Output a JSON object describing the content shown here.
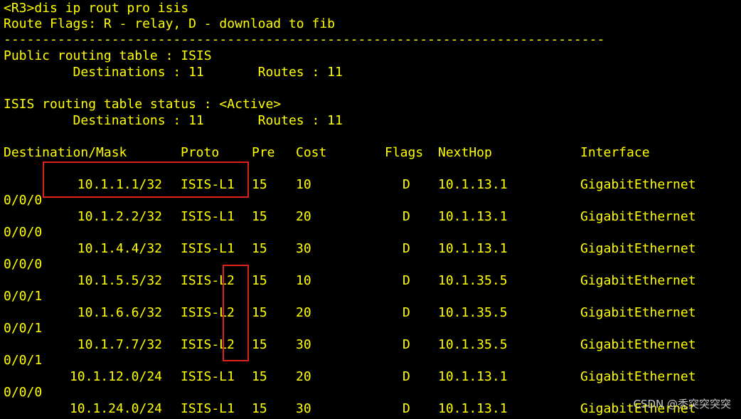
{
  "header": {
    "command_line": "<R3>dis ip rout pro isis",
    "flags_legend": "Route Flags: R - relay, D - download to fib",
    "separator": "------------------------------------------------------------------------------",
    "public_title": "Public routing table : ISIS",
    "public_counts": "         Destinations : 11       Routes : 11",
    "status_title": "ISIS routing table status : <Active>",
    "status_counts": "         Destinations : 11       Routes : 11"
  },
  "columns": [
    "Destination/Mask",
    "Proto",
    "Pre",
    "Cost",
    "Flags",
    "NextHop",
    "Interface"
  ],
  "routes": [
    {
      "dest": "10.1.1.1/32",
      "proto": "ISIS-L1",
      "pre": "15",
      "cost": "10",
      "flags": "D",
      "nexthop": "10.1.13.1",
      "iface": "GigabitEthernet",
      "iface_cont": "0/0/0"
    },
    {
      "dest": "10.1.2.2/32",
      "proto": "ISIS-L1",
      "pre": "15",
      "cost": "20",
      "flags": "D",
      "nexthop": "10.1.13.1",
      "iface": "GigabitEthernet",
      "iface_cont": "0/0/0"
    },
    {
      "dest": "10.1.4.4/32",
      "proto": "ISIS-L1",
      "pre": "15",
      "cost": "30",
      "flags": "D",
      "nexthop": "10.1.13.1",
      "iface": "GigabitEthernet",
      "iface_cont": "0/0/0"
    },
    {
      "dest": "10.1.5.5/32",
      "proto": "ISIS-L2",
      "pre": "15",
      "cost": "10",
      "flags": "D",
      "nexthop": "10.1.35.5",
      "iface": "GigabitEthernet",
      "iface_cont": "0/0/1"
    },
    {
      "dest": "10.1.6.6/32",
      "proto": "ISIS-L2",
      "pre": "15",
      "cost": "20",
      "flags": "D",
      "nexthop": "10.1.35.5",
      "iface": "GigabitEthernet",
      "iface_cont": "0/0/1"
    },
    {
      "dest": "10.1.7.7/32",
      "proto": "ISIS-L2",
      "pre": "15",
      "cost": "30",
      "flags": "D",
      "nexthop": "10.1.35.5",
      "iface": "GigabitEthernet",
      "iface_cont": "0/0/1"
    },
    {
      "dest": "10.1.12.0/24",
      "proto": "ISIS-L1",
      "pre": "15",
      "cost": "20",
      "flags": "D",
      "nexthop": "10.1.13.1",
      "iface": "GigabitEthernet",
      "iface_cont": "0/0/0"
    },
    {
      "dest": "10.1.24.0/24",
      "proto": "ISIS-L1",
      "pre": "15",
      "cost": "30",
      "flags": "D",
      "nexthop": "10.1.13.1",
      "iface": "GigabitEthernet",
      "iface_cont": ""
    }
  ],
  "watermark": "CSDN @秃突突突突",
  "colors": {
    "background": "#000000",
    "text": "#ffff00",
    "highlight_box": "#e0201a",
    "watermark": "#c8c8c8"
  }
}
